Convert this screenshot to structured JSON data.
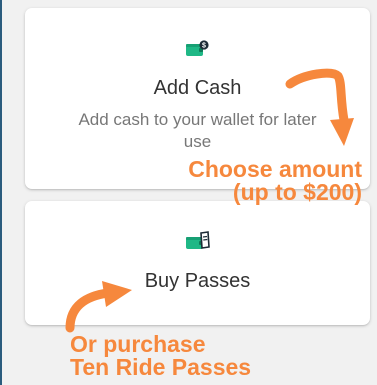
{
  "cards": {
    "add_cash": {
      "title": "Add Cash",
      "description": "Add cash to your wallet for later use",
      "icon": "wallet-cash-icon"
    },
    "buy_passes": {
      "title": "Buy Passes",
      "icon": "wallet-ticket-icon"
    }
  },
  "annotations": {
    "choose_line1": "Choose amount",
    "choose_line2": "(up to $200)",
    "purchase_line1": "Or purchase",
    "purchase_line2": "Ten Ride Passes"
  },
  "colors": {
    "accent": "#f6883d",
    "wallet": "#1fb886",
    "title_text": "#333333",
    "description_text": "#777777"
  }
}
